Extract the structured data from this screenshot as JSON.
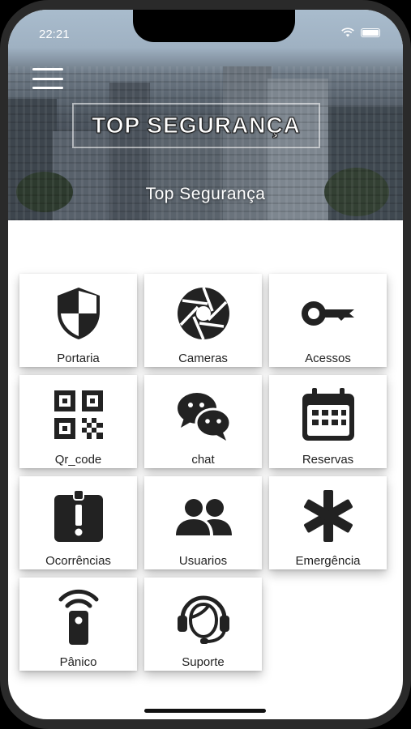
{
  "status_bar": {
    "time": "22:21"
  },
  "header": {
    "logo_text": "TOP SEGURANÇA",
    "title": "Top Segurança"
  },
  "menu": [
    {
      "label": "Portaria",
      "icon": "shield-icon"
    },
    {
      "label": "Cameras",
      "icon": "camera-aperture-icon"
    },
    {
      "label": "Acessos",
      "icon": "key-icon"
    },
    {
      "label": "Qr_code",
      "icon": "qr-code-icon"
    },
    {
      "label": "chat",
      "icon": "chat-bubbles-icon"
    },
    {
      "label": "Reservas",
      "icon": "calendar-icon"
    },
    {
      "label": "Ocorrências",
      "icon": "clipboard-alert-icon"
    },
    {
      "label": "Usuarios",
      "icon": "users-icon"
    },
    {
      "label": "Emergência",
      "icon": "asterisk-icon"
    },
    {
      "label": "Pânico",
      "icon": "panic-remote-icon"
    },
    {
      "label": "Suporte",
      "icon": "headset-support-icon"
    }
  ],
  "colors": {
    "icon": "#222222",
    "tile_bg": "#ffffff",
    "label": "#222222"
  }
}
